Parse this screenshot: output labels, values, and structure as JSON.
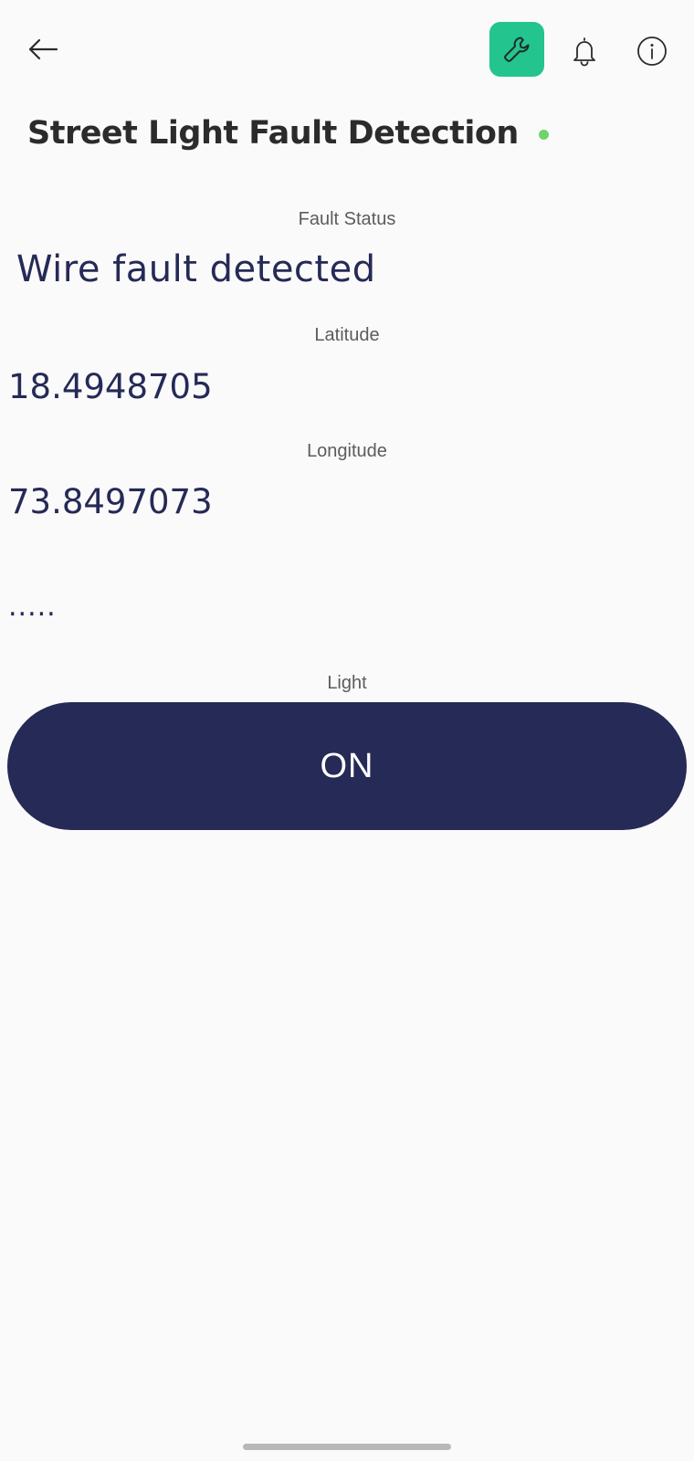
{
  "header": {
    "title": "Street Light Fault Detection",
    "online_status_color": "#6fd46a",
    "icons": {
      "back": "arrow-left-icon",
      "tool": "wrench-icon",
      "bell": "bell-icon",
      "info": "info-icon"
    },
    "tool_button_color": "#23c48e"
  },
  "widgets": {
    "fault_status": {
      "label": "Fault Status",
      "value": "Wire fault detected"
    },
    "latitude": {
      "label": "Latitude",
      "value": "18.4948705"
    },
    "longitude": {
      "label": "Longitude",
      "value": "73.8497073"
    },
    "extra": {
      "value": "....."
    },
    "light": {
      "label": "Light",
      "button_label": "ON",
      "button_color": "#252a56"
    }
  }
}
